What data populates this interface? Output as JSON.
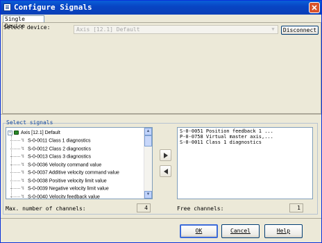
{
  "window": {
    "title": "Configure Signals",
    "close_icon": "close-x-icon"
  },
  "tab": {
    "label": "Single Device"
  },
  "device": {
    "label": "Select device:",
    "selected": "Axis [12.1] Default",
    "disconnect_label": "Disconnect"
  },
  "signals": {
    "group_title": "Select signals",
    "tree": {
      "root": "Axis [12.1] Default",
      "items": [
        "S-0-0011 Class 1 diagnostics",
        "S-0-0012 Class 2 diagnostics",
        "S-0-0013 Class 3 diagnostics",
        "S-0-0036 Velocity command value",
        "S-0-0037 Additive velocity command value",
        "S-0-0038 Positive velocity limit value",
        "S-0-0039 Negative velocity limit value",
        "S-0-0040 Velocity feedback value"
      ]
    },
    "selected": [
      "S-0-0051 Position feedback 1 ...",
      "P-0-0758 Virtual master axis,...",
      "S-0-0011 Class 1 diagnostics"
    ],
    "max_channels_label": "Max. number of channels:",
    "max_channels_value": "4",
    "free_channels_label": "Free channels:",
    "free_channels_value": "1"
  },
  "buttons": {
    "ok_label": "OK",
    "cancel_label": "Cancel",
    "help_label": "Help"
  },
  "colors": {
    "titlebar": "#0a5fd8",
    "dialog_bg": "#ece9d8",
    "close_button": "#d9532b",
    "group_title": "#1a4da0"
  }
}
